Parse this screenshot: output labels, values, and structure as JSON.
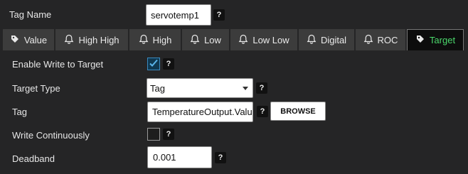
{
  "tag_name": {
    "label": "Tag Name",
    "value": "servotemp1"
  },
  "help_symbol": "?",
  "tabs": [
    {
      "label": "Value",
      "icon": "tag-icon",
      "active": false
    },
    {
      "label": "High High",
      "icon": "bell-icon",
      "active": false
    },
    {
      "label": "High",
      "icon": "bell-icon",
      "active": false
    },
    {
      "label": "Low",
      "icon": "bell-icon",
      "active": false
    },
    {
      "label": "Low Low",
      "icon": "bell-icon",
      "active": false
    },
    {
      "label": "Digital",
      "icon": "bell-icon",
      "active": false
    },
    {
      "label": "ROC",
      "icon": "bell-icon",
      "active": false
    },
    {
      "label": "Target",
      "icon": "tag-icon",
      "active": true
    }
  ],
  "form": {
    "enable_write": {
      "label": "Enable Write to Target",
      "checked": true
    },
    "target_type": {
      "label": "Target Type",
      "value": "Tag"
    },
    "tag": {
      "label": "Tag",
      "value": "TemperatureOutput.Value",
      "browse_label": "BROWSE"
    },
    "write_continuously": {
      "label": "Write Continuously",
      "checked": false
    },
    "deadband": {
      "label": "Deadband",
      "value": "0.001"
    }
  },
  "colors": {
    "active_tab_text": "#4bd86b",
    "checkbox_checked": "#0f3850",
    "checkmark": "#5ab4ea"
  }
}
